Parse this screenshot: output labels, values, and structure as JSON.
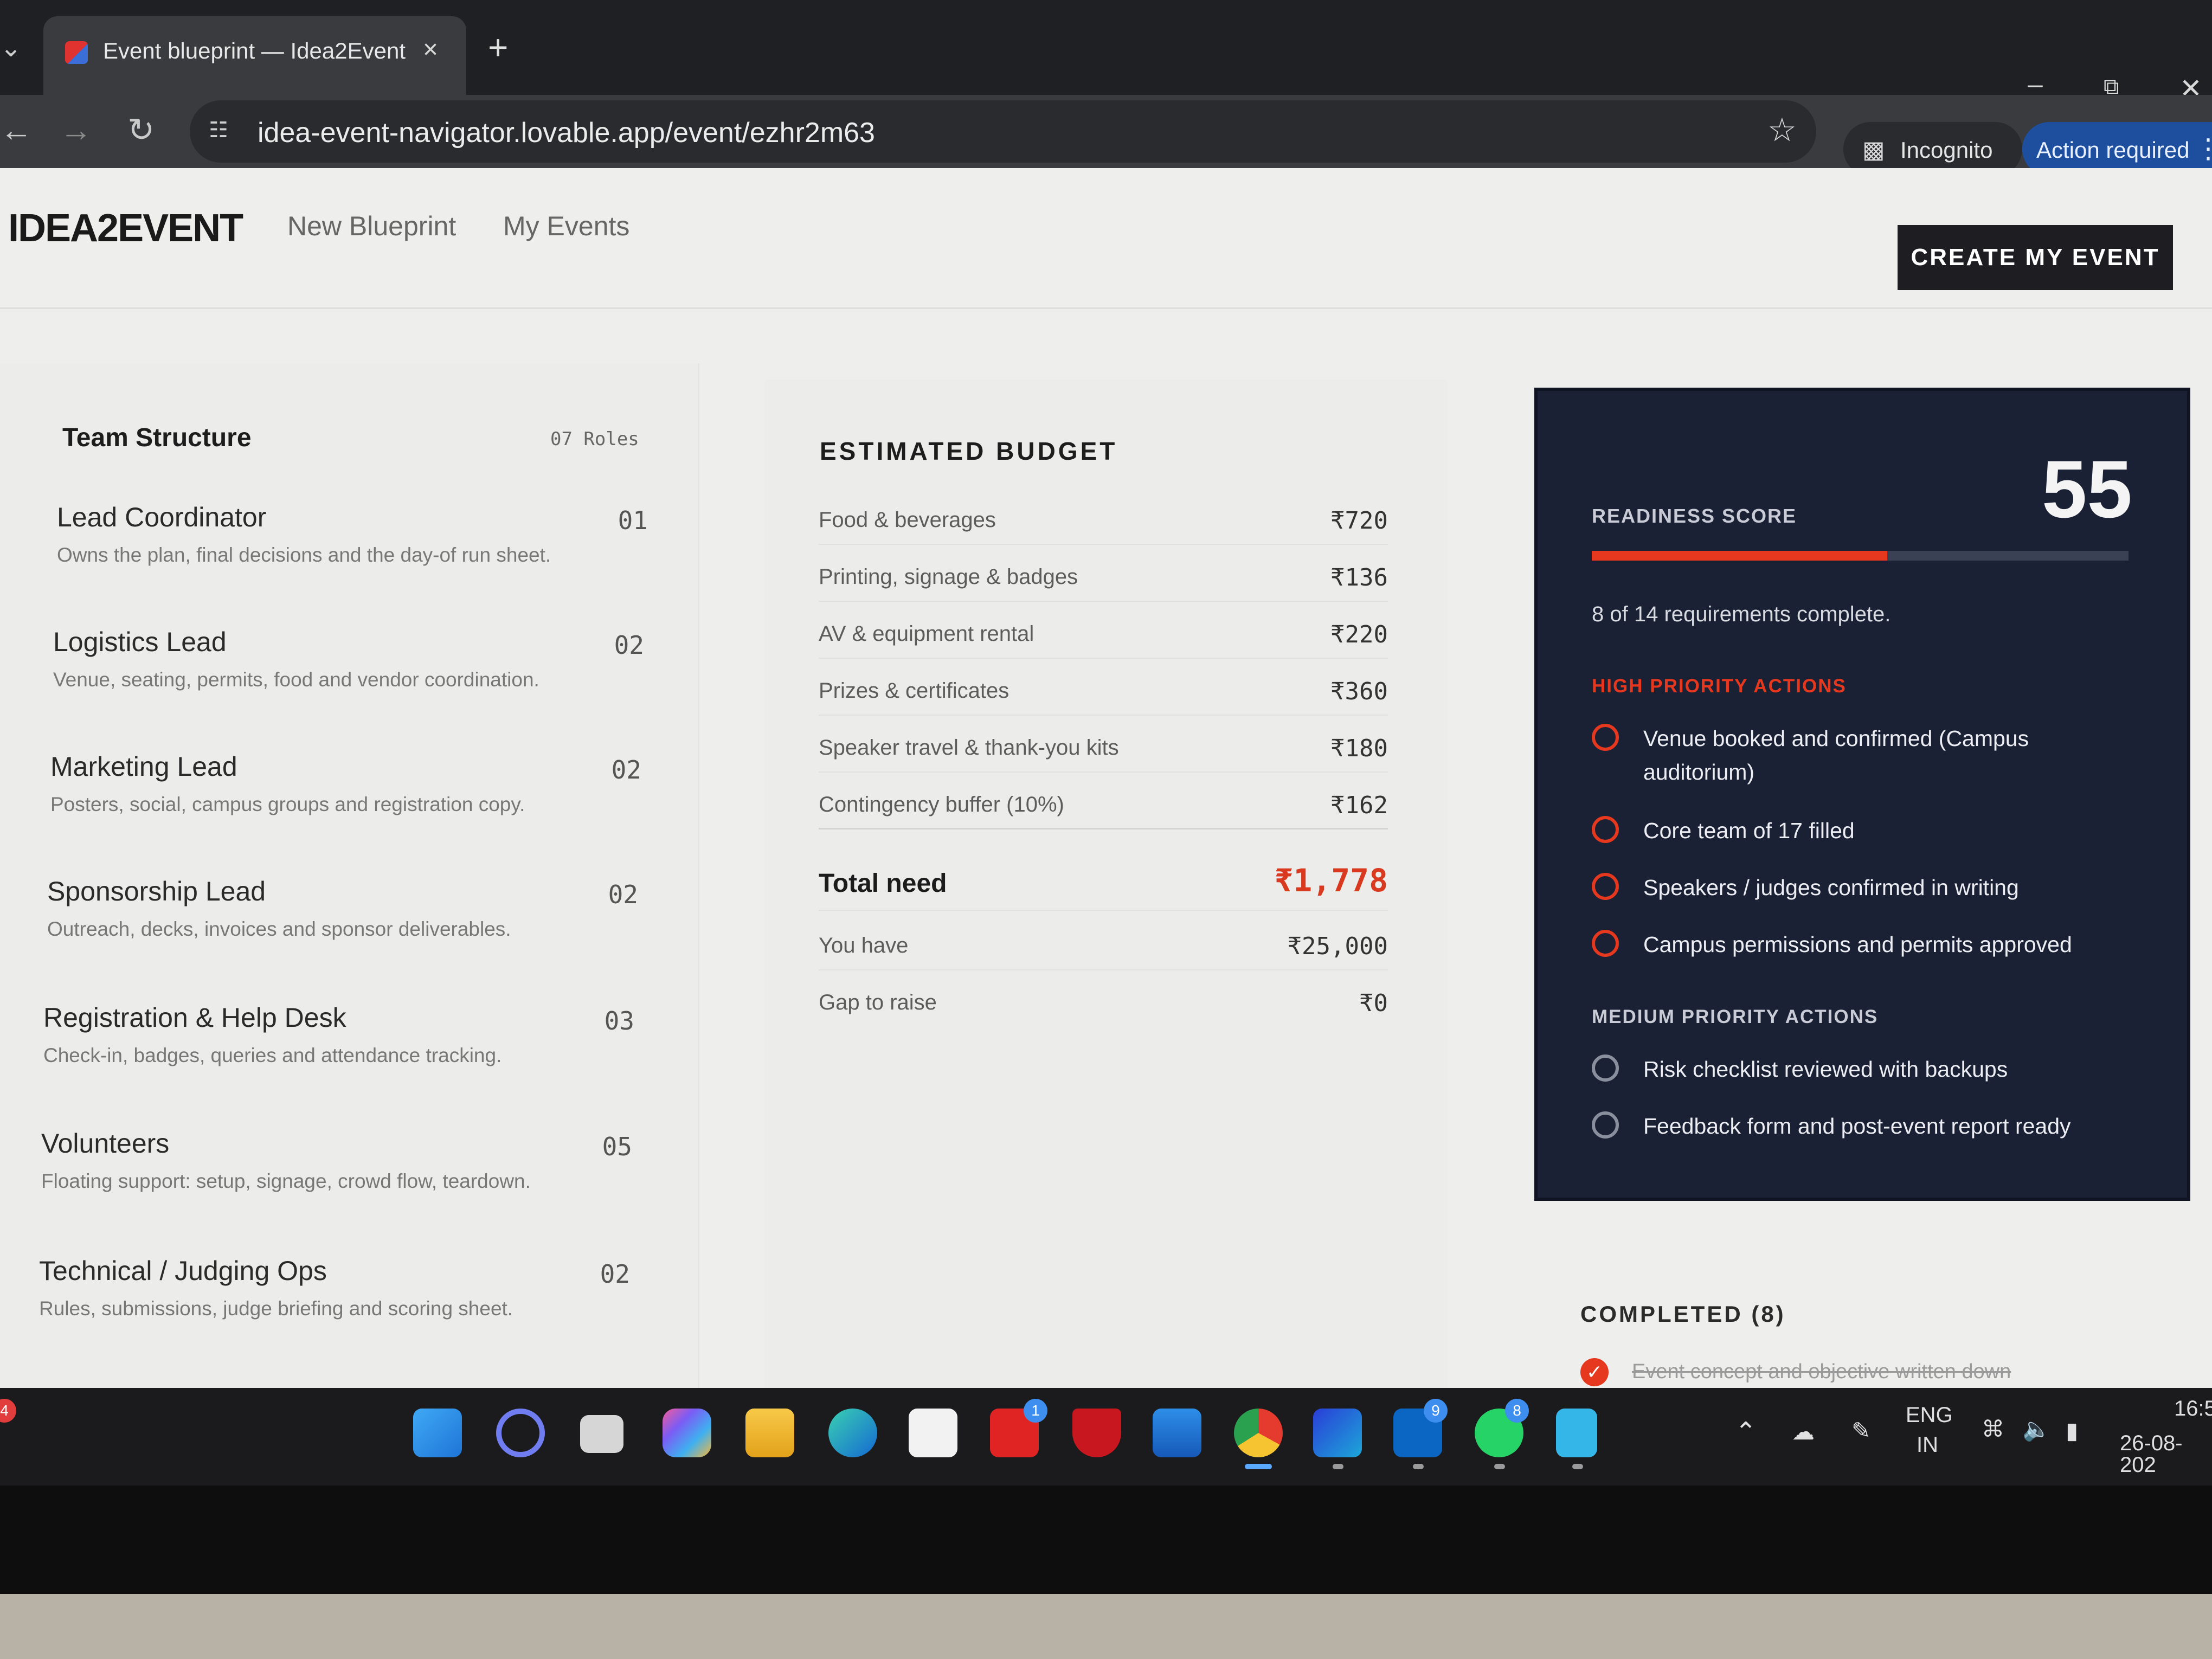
{
  "browser": {
    "tab_title": "Event blueprint — Idea2Event",
    "url": "idea-event-navigator.lovable.app/event/ezhr2m63",
    "incognito_label": "Incognito",
    "action_label": "Action required"
  },
  "header": {
    "logo": "IDEA2EVENT",
    "nav": [
      "New Blueprint",
      "My Events"
    ],
    "cta": "CREATE MY EVENT"
  },
  "team": {
    "title": "Team Structure",
    "count": "07 Roles",
    "roles": [
      {
        "name": "Lead Coordinator",
        "num": "01",
        "desc": "Owns the plan, final decisions and the day-of run sheet."
      },
      {
        "name": "Logistics Lead",
        "num": "02",
        "desc": "Venue, seating, permits, food and vendor coordination."
      },
      {
        "name": "Marketing Lead",
        "num": "02",
        "desc": "Posters, social, campus groups and registration copy."
      },
      {
        "name": "Sponsorship Lead",
        "num": "02",
        "desc": "Outreach, decks, invoices and sponsor deliverables."
      },
      {
        "name": "Registration & Help Desk",
        "num": "03",
        "desc": "Check-in, badges, queries and attendance tracking."
      },
      {
        "name": "Volunteers",
        "num": "05",
        "desc": "Floating support: setup, signage, crowd flow, teardown."
      },
      {
        "name": "Technical / Judging Ops",
        "num": "02",
        "desc": "Rules, submissions, judge briefing and scoring sheet."
      }
    ]
  },
  "budget": {
    "title": "ESTIMATED BUDGET",
    "items": [
      {
        "label": "Food & beverages",
        "value": "₹720"
      },
      {
        "label": "Printing, signage & badges",
        "value": "₹136"
      },
      {
        "label": "AV & equipment rental",
        "value": "₹220"
      },
      {
        "label": "Prizes & certificates",
        "value": "₹360"
      },
      {
        "label": "Speaker travel & thank-you kits",
        "value": "₹180"
      },
      {
        "label": "Contingency buffer (10%)",
        "value": "₹162"
      }
    ],
    "total_label": "Total need",
    "total_value": "₹1,778",
    "have_label": "You have",
    "have_value": "₹25,000",
    "gap_label": "Gap to raise",
    "gap_value": "₹0"
  },
  "readiness": {
    "label": "READINESS SCORE",
    "score": "55",
    "progress_fraction": 0.55,
    "requirements": "8 of 14 requirements complete.",
    "high_title": "HIGH PRIORITY ACTIONS",
    "high_actions": [
      "Venue booked and confirmed (Campus auditorium)",
      "Core team of 17 filled",
      "Speakers / judges confirmed in writing",
      "Campus permissions and permits approved"
    ],
    "medium_title": "MEDIUM PRIORITY ACTIONS",
    "medium_actions": [
      "Risk checklist reviewed with backups",
      "Feedback form and post-event report ready"
    ],
    "accent_color": "#e5381e"
  },
  "completed": {
    "title": "COMPLETED (8)",
    "first_item": "Event concept and objective written down"
  },
  "taskbar": {
    "lang_line1": "ENG",
    "lang_line2": "IN",
    "time": "16:5",
    "date": "26-08-202",
    "badges": {
      "lens": "1",
      "linkedin": "9",
      "whatsapp": "8",
      "left": "4"
    }
  }
}
